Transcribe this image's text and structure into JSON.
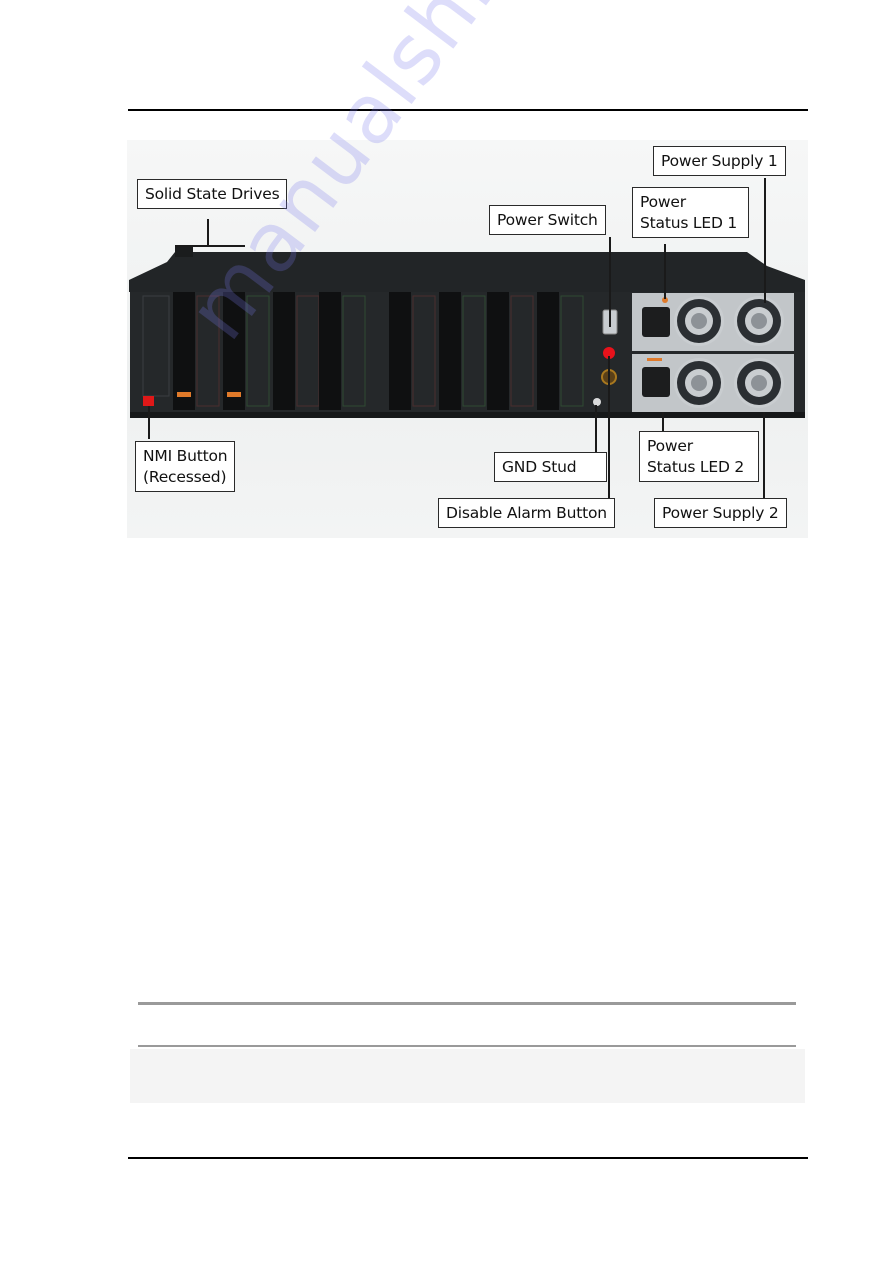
{
  "figure": {
    "subject": "Appliance rear panel",
    "callouts": {
      "solid_state_drives": "Solid State Drives",
      "power_switch": "Power Switch",
      "power_status_led_1": "Power\nStatus LED 1",
      "power_supply_1": "Power Supply 1",
      "nmi_button": "NMI Button\n(Recessed)",
      "gnd_stud": "GND Stud",
      "disable_alarm_button": "Disable Alarm Button",
      "power_status_led_2": "Power\nStatus LED 2",
      "power_supply_2": "Power Supply 2"
    }
  },
  "colors": {
    "chassis": "#1f2224",
    "psu": "#c2c6c9",
    "alarm_led": "#e8121b",
    "nmi_button": "#e01818",
    "accent_orange": "#e07a2a",
    "watermark": "#7878eb"
  },
  "watermark": "manualshive.com"
}
